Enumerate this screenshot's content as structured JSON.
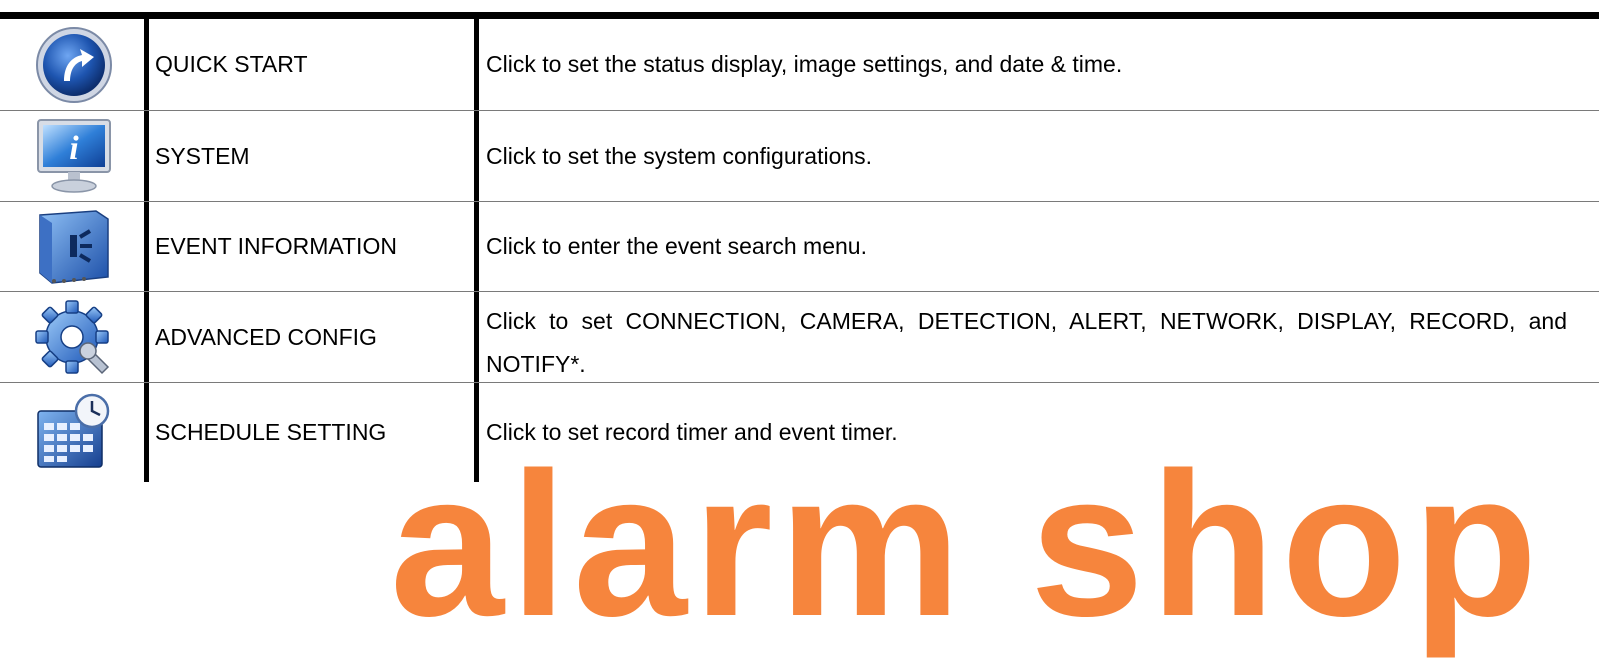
{
  "rows": [
    {
      "name": "QUICK START",
      "icon": "quick-start-icon",
      "desc": "Click to set the status display, image settings, and date & time."
    },
    {
      "name": "SYSTEM",
      "icon": "system-monitor-icon",
      "desc": "Click to set the system configurations."
    },
    {
      "name": "EVENT INFORMATION",
      "icon": "event-information-icon",
      "desc": "Click to enter the event search menu."
    },
    {
      "name": "ADVANCED CONFIG",
      "icon": "advanced-config-icon",
      "desc": "Click to set CONNECTION, CAMERA, DETECTION, ALERT, NETWORK, DISPLAY, RECORD, and NOTIFY*."
    },
    {
      "name": "SCHEDULE SETTING",
      "icon": "schedule-calendar-clock-icon",
      "desc": "Click to set record timer and event timer."
    }
  ],
  "watermark": "alarm shop",
  "colors": {
    "watermark": "#f5701c",
    "icon_blue": "#1e55b0"
  }
}
